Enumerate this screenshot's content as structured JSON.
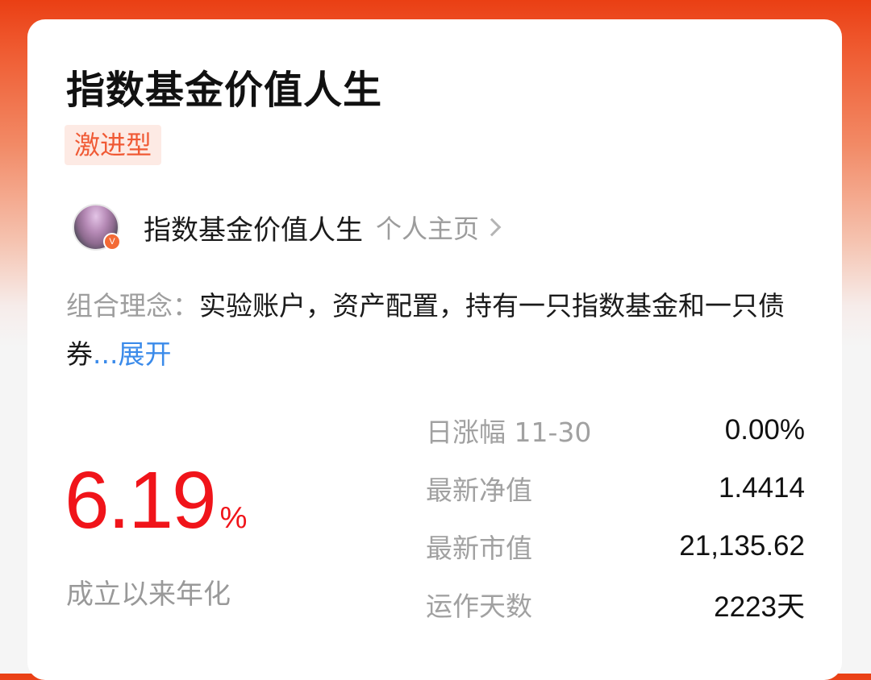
{
  "portfolio": {
    "title": "指数基金价值人生",
    "risk_tag": "激进型"
  },
  "author": {
    "name": "指数基金价值人生",
    "homepage_link": "个人主页",
    "verified_badge": "V"
  },
  "philosophy": {
    "label": "组合理念：",
    "text": "实验账户，资产配置，持有一只指数基金和一只债券",
    "ellipsis": "...",
    "expand": "展开"
  },
  "annualized": {
    "value": "6.19",
    "unit": "%",
    "label": "成立以来年化",
    "color": "#f0141a"
  },
  "stats": [
    {
      "label": "日涨幅 11-30",
      "value": "0.00%"
    },
    {
      "label": "最新净值",
      "value": "1.4414"
    },
    {
      "label": "最新市值",
      "value": "21,135.62"
    },
    {
      "label": "运作天数",
      "value": "2223天"
    }
  ],
  "colors": {
    "accent_orange": "#f05a35",
    "link_blue": "#3b8bea"
  }
}
